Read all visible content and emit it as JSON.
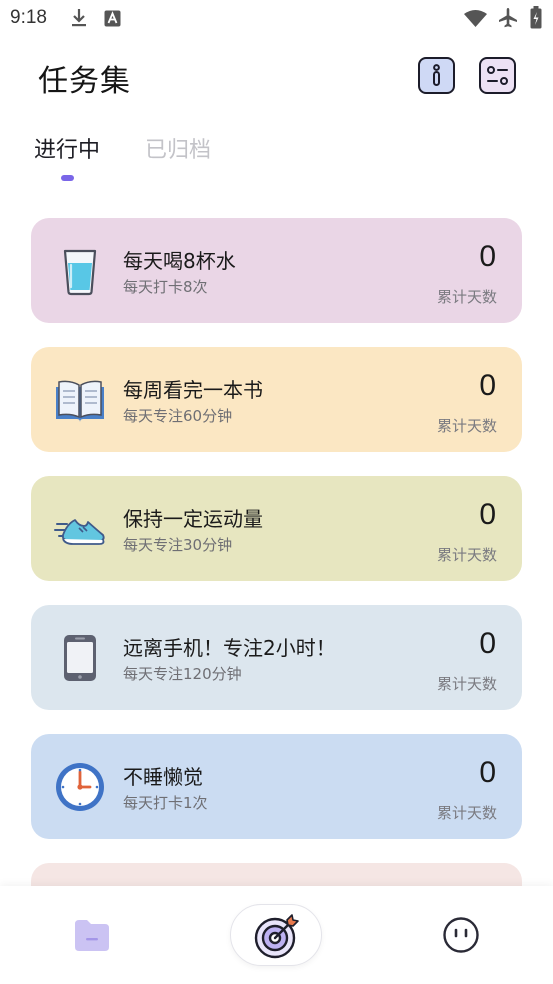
{
  "status_bar": {
    "time": "9:18",
    "left_icons": [
      "download-icon",
      "app-a-icon"
    ],
    "right_icons": [
      "wifi-icon",
      "airplane-icon",
      "battery-icon"
    ]
  },
  "header": {
    "title": "任务集",
    "buttons": [
      {
        "name": "info-button",
        "icon": "info-icon",
        "bg": "#cfd9f5"
      },
      {
        "name": "settings-button",
        "icon": "settings-sliders-icon",
        "bg": "#ece1f4"
      }
    ]
  },
  "tabs": [
    {
      "label": "进行中",
      "active": true
    },
    {
      "label": "已归档",
      "active": false
    }
  ],
  "colors": {
    "accent": "#7a66e8"
  },
  "tasks": [
    {
      "title": "每天喝8杯水",
      "subtitle": "每天打卡8次",
      "count": "0",
      "count_label": "累计天数",
      "icon": "water-glass-icon",
      "bg": "#ead6e6"
    },
    {
      "title": "每周看完一本书",
      "subtitle": "每天专注60分钟",
      "count": "0",
      "count_label": "累计天数",
      "icon": "open-book-icon",
      "bg": "#fbe7c3"
    },
    {
      "title": "保持一定运动量",
      "subtitle": "每天专注30分钟",
      "count": "0",
      "count_label": "累计天数",
      "icon": "running-shoe-icon",
      "bg": "#e7e6c0"
    },
    {
      "title": "远离手机！专注2小时！",
      "subtitle": "每天专注120分钟",
      "count": "0",
      "count_label": "累计天数",
      "icon": "phone-icon",
      "bg": "#dce6ee"
    },
    {
      "title": "不睡懒觉",
      "subtitle": "每天打卡1次",
      "count": "0",
      "count_label": "累计天数",
      "icon": "alarm-clock-icon",
      "bg": "#cbdcf2"
    }
  ],
  "partial_card_bg": "#f5e6e4",
  "bottom_nav": [
    {
      "name": "nav-folder",
      "icon": "folder-icon",
      "active": true
    },
    {
      "name": "nav-target",
      "icon": "target-icon",
      "active": false
    },
    {
      "name": "nav-profile",
      "icon": "face-icon",
      "active": false
    }
  ]
}
